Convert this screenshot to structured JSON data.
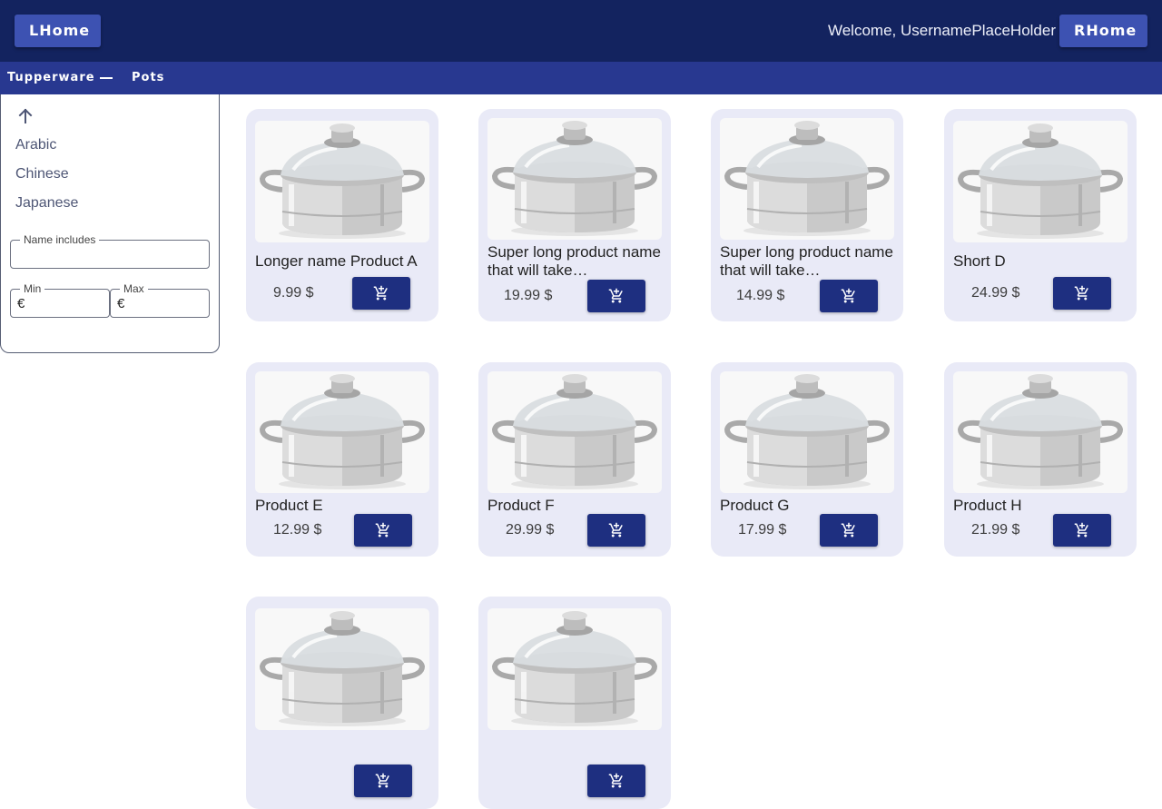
{
  "header": {
    "left_button": "LHome",
    "welcome": "Welcome, UsernamePlaceHolder",
    "right_button": "RHome"
  },
  "breadcrumb": {
    "items": [
      "Tupperware",
      "Pots"
    ]
  },
  "sidebar": {
    "up_icon": "arrow-up-icon",
    "categories": [
      "Arabic",
      "Chinese",
      "Japanese"
    ],
    "name_filter": {
      "label": "Name includes",
      "value": ""
    },
    "min_filter": {
      "label": "Min",
      "prefix": "€",
      "value": ""
    },
    "max_filter": {
      "label": "Max",
      "prefix": "€",
      "value": ""
    }
  },
  "products": [
    {
      "name": "Longer name Product A",
      "price": "9.99 $"
    },
    {
      "name": "Super long product name that will take…",
      "price": "19.99 $"
    },
    {
      "name": "Super long product name that will take…",
      "price": "14.99 $"
    },
    {
      "name": "Short D",
      "price": "24.99 $"
    },
    {
      "name": "Product E",
      "price": "12.99 $"
    },
    {
      "name": "Product F",
      "price": "29.99 $"
    },
    {
      "name": "Product G",
      "price": "17.99 $"
    },
    {
      "name": "Product H",
      "price": "21.99 $"
    },
    {
      "name": "",
      "price": ""
    },
    {
      "name": "",
      "price": ""
    }
  ],
  "icons": {
    "cart": "add-shopping-cart-icon",
    "product_image": "cooking-pot-icon"
  },
  "colors": {
    "header": "#13235f",
    "subheader": "#283890",
    "button": "#3d52b2",
    "cart_button": "#1e2f80",
    "card": "#e9eaf7"
  }
}
